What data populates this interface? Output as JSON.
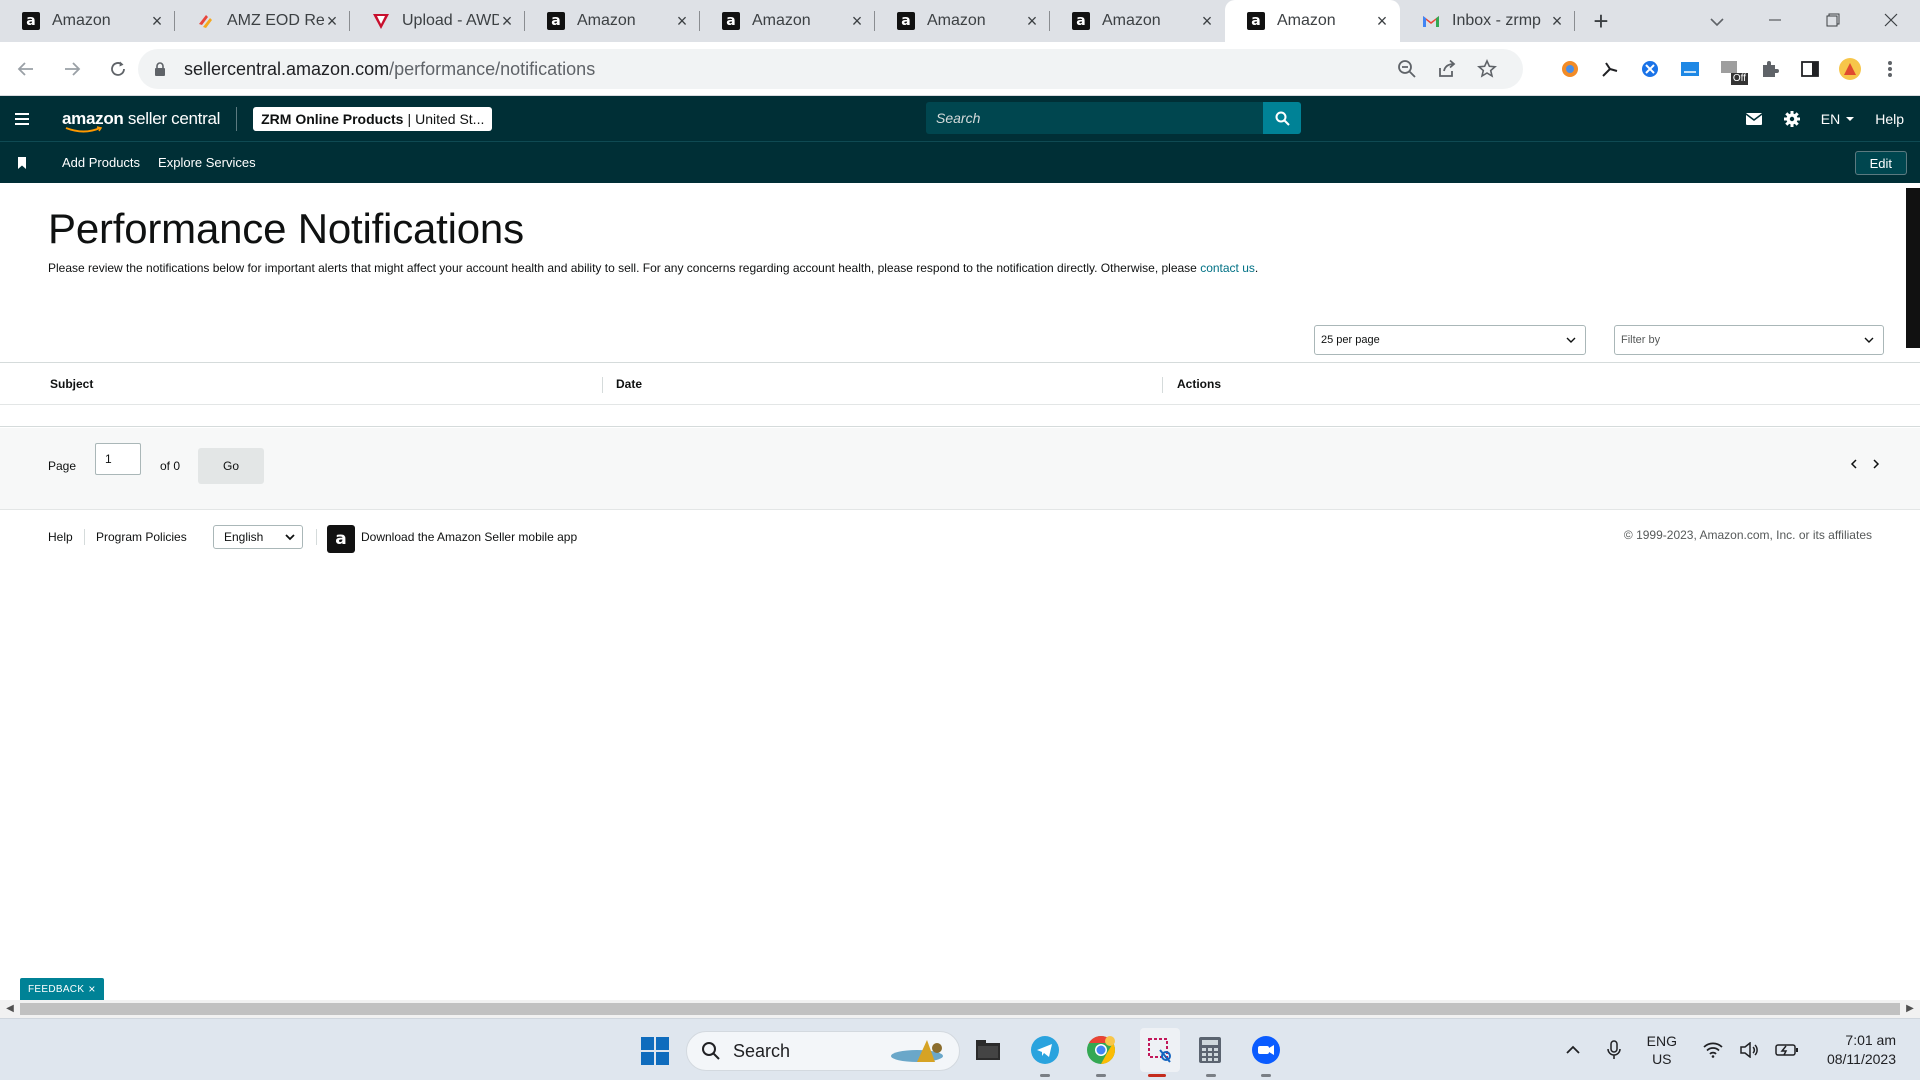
{
  "browser": {
    "tabs": [
      {
        "label": "Amazon",
        "favicon": "amazon-icon"
      },
      {
        "label": "AMZ EOD Rep",
        "favicon": "zoho-icon"
      },
      {
        "label": "Upload - AWD",
        "favicon": "upload-icon"
      },
      {
        "label": "Amazon",
        "favicon": "amazon-icon"
      },
      {
        "label": "Amazon",
        "favicon": "amazon-icon"
      },
      {
        "label": "Amazon",
        "favicon": "amazon-icon"
      },
      {
        "label": "Amazon",
        "favicon": "amazon-icon"
      },
      {
        "label": "Amazon",
        "favicon": "amazon-icon",
        "active": true
      },
      {
        "label": "Inbox - zrmp",
        "favicon": "gmail-icon"
      }
    ],
    "url_host": "sellercentral.amazon.com",
    "url_path": "/performance/notifications",
    "extension_badge": "Off"
  },
  "header": {
    "logo_primary": "amazon",
    "logo_secondary": " seller central",
    "account_name": "ZRM Online Products",
    "account_separator": "|",
    "account_region": "United St...",
    "search_placeholder": "Search",
    "language": "EN",
    "help_label": "Help"
  },
  "subnav": {
    "links": [
      "Add Products",
      "Explore Services"
    ],
    "edit_label": "Edit"
  },
  "main": {
    "title": "Performance Notifications",
    "description": "Please review the notifications below for important alerts that might affect your account health and ability to sell. For any concerns regarding account health, please respond to the notification directly. Otherwise, please ",
    "contact_link": "contact us",
    "description_end": ".",
    "per_page": "25 per page",
    "filter_placeholder": "Filter by",
    "columns": [
      "Subject",
      "Date",
      "Actions"
    ],
    "pager": {
      "page_label": "Page",
      "page_value": "1",
      "of_label": "of 0",
      "go_label": "Go"
    }
  },
  "footer": {
    "help": "Help",
    "program_policies": "Program Policies",
    "language": "English",
    "app_link": "Download the Amazon Seller mobile app",
    "copyright": "© 1999-2023, Amazon.com, Inc. or its affiliates"
  },
  "feedback_label": "FEEDBACK",
  "taskbar": {
    "search_label": "Search",
    "lang_top": "ENG",
    "lang_bottom": "US",
    "time": "7:01 am",
    "date": "08/11/2023"
  },
  "colors": {
    "header_bg": "#002f36",
    "accent_teal": "#008296",
    "link": "#007185"
  }
}
